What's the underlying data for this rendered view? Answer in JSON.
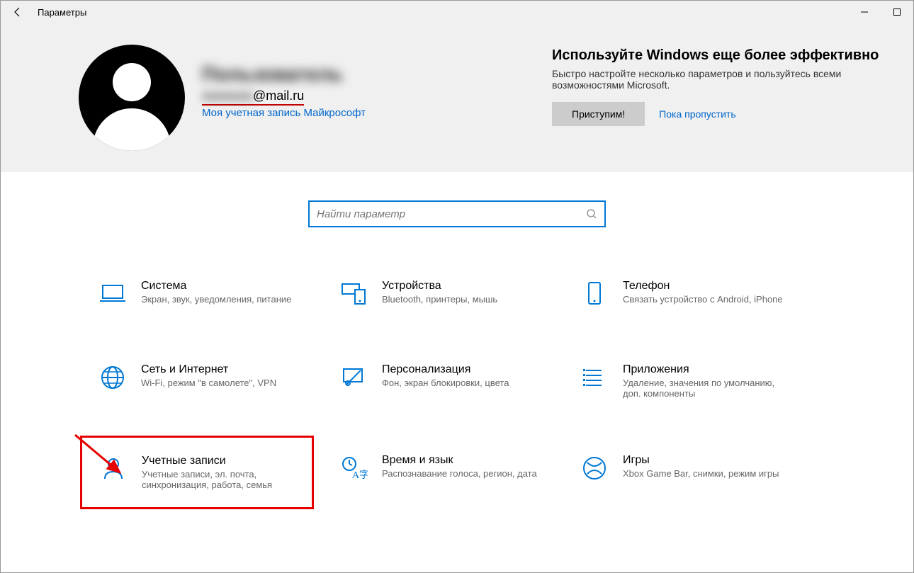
{
  "window": {
    "title": "Параметры"
  },
  "user": {
    "name": "Пользователь",
    "email_prefix": "xxxxxxxx",
    "email_suffix": "@mail.ru",
    "account_link": "Моя учетная запись Майкрософт"
  },
  "promo": {
    "title": "Используйте Windows еще более эффективно",
    "subtitle": "Быстро настройте несколько параметров и пользуйтесь всеми возможностями Microsoft.",
    "button": "Приступим!",
    "skip": "Пока пропустить"
  },
  "search": {
    "placeholder": "Найти параметр"
  },
  "tiles": [
    {
      "title": "Система",
      "sub": "Экран, звук, уведомления, питание"
    },
    {
      "title": "Устройства",
      "sub": "Bluetooth, принтеры, мышь"
    },
    {
      "title": "Телефон",
      "sub": "Связать устройство с Android, iPhone"
    },
    {
      "title": "Сеть и Интернет",
      "sub": "Wi-Fi, режим \"в самолете\", VPN"
    },
    {
      "title": "Персонализация",
      "sub": "Фон, экран блокировки, цвета"
    },
    {
      "title": "Приложения",
      "sub": "Удаление, значения по умолчанию, доп. компоненты"
    },
    {
      "title": "Учетные записи",
      "sub": "Учетные записи, эл. почта, синхронизация, работа, семья"
    },
    {
      "title": "Время и язык",
      "sub": "Распознавание голоса, регион, дата"
    },
    {
      "title": "Игры",
      "sub": "Xbox Game Bar, снимки, режим игры"
    }
  ]
}
